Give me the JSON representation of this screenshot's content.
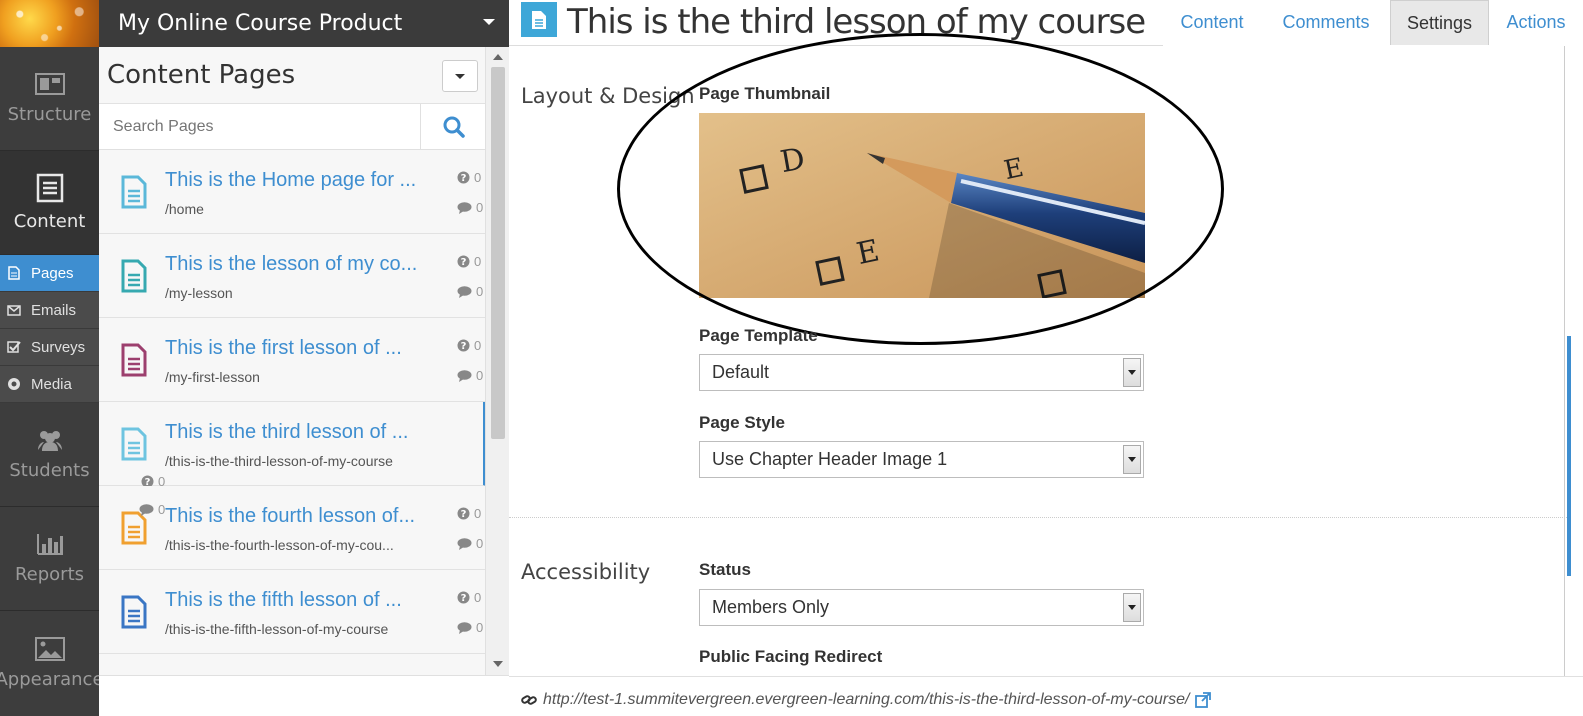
{
  "project": {
    "name": "My Online Course Product"
  },
  "nav": {
    "structure": "Structure",
    "content": "Content",
    "sub": [
      {
        "label": "Pages"
      },
      {
        "label": "Emails"
      },
      {
        "label": "Surveys"
      },
      {
        "label": "Media"
      }
    ],
    "students": "Students",
    "reports": "Reports",
    "appearance": "Appearance"
  },
  "pages_panel": {
    "heading": "Content Pages",
    "search_placeholder": "Search Pages",
    "items": [
      {
        "title": "This is the Home page for ...",
        "slug": "/home",
        "questions": "0",
        "comments": "0",
        "icon_color": "#5bb8d9"
      },
      {
        "title": "This is the lesson of my co...",
        "slug": "/my-lesson",
        "questions": "0",
        "comments": "0",
        "icon_color": "#36a9b0"
      },
      {
        "title": "This is the first lesson of ...",
        "slug": "/my-first-lesson",
        "questions": "0",
        "comments": "0",
        "icon_color": "#9c3f6e"
      },
      {
        "title": "This is the third lesson of ...",
        "slug": "/this-is-the-third-lesson-of-my-course",
        "questions": "0",
        "comments": "0",
        "icon_color": "#6ec4e0"
      },
      {
        "title": "This is the fourth lesson of...",
        "slug": "/this-is-the-fourth-lesson-of-my-cou...",
        "questions": "0",
        "comments": "0",
        "icon_color": "#f0a030"
      },
      {
        "title": "This is the fifth lesson of ...",
        "slug": "/this-is-the-fifth-lesson-of-my-course",
        "questions": "0",
        "comments": "0",
        "icon_color": "#3a76c4"
      }
    ]
  },
  "main": {
    "title": "This is the third lesson of my course",
    "tabs": [
      "Content",
      "Comments",
      "Settings",
      "Actions"
    ],
    "active_tab": "Settings",
    "layout_section": "Layout & Design",
    "thumbnail_label": "Page Thumbnail",
    "template_label": "Page Template",
    "template_value": "Default",
    "style_label": "Page Style",
    "style_value": "Use Chapter Header Image 1",
    "accessibility_section": "Accessibility",
    "status_label": "Status",
    "status_value": "Members Only",
    "redirect_label": "Public Facing Redirect",
    "url": "http://test-1.summitevergreen.evergreen-learning.com/this-is-the-third-lesson-of-my-course/"
  }
}
